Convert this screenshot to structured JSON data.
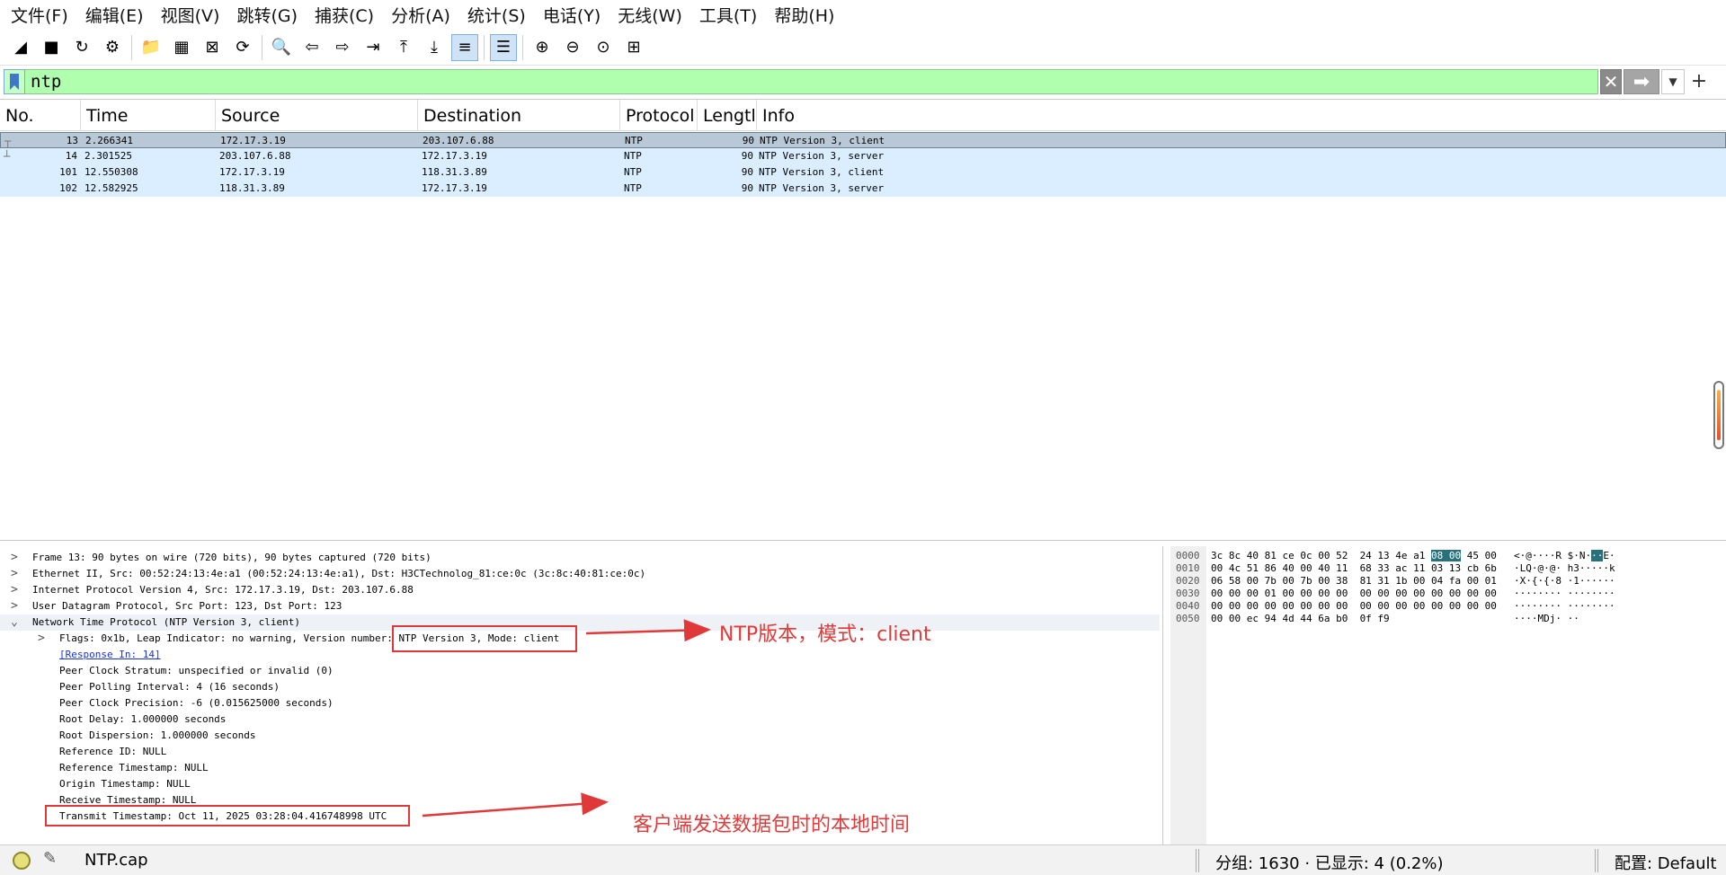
{
  "menu": [
    "文件(F)",
    "编辑(E)",
    "视图(V)",
    "跳转(G)",
    "捕获(C)",
    "分析(A)",
    "统计(S)",
    "电话(Y)",
    "无线(W)",
    "工具(T)",
    "帮助(H)"
  ],
  "toolbar": {
    "icons": [
      {
        "name": "start-capture-icon",
        "glyph": "◢"
      },
      {
        "name": "stop-capture-icon",
        "glyph": "■"
      },
      {
        "name": "restart-capture-icon",
        "glyph": "↻"
      },
      {
        "name": "capture-options-icon",
        "glyph": "⚙"
      },
      {
        "name": "sep"
      },
      {
        "name": "open-file-icon",
        "glyph": "📁"
      },
      {
        "name": "save-file-icon",
        "glyph": "▦"
      },
      {
        "name": "close-file-icon",
        "glyph": "⊠"
      },
      {
        "name": "reload-file-icon",
        "glyph": "⟳"
      },
      {
        "name": "sep"
      },
      {
        "name": "find-packet-icon",
        "glyph": "🔍"
      },
      {
        "name": "go-back-icon",
        "glyph": "⇦"
      },
      {
        "name": "go-forward-icon",
        "glyph": "⇨"
      },
      {
        "name": "go-to-packet-icon",
        "glyph": "⇥"
      },
      {
        "name": "go-first-packet-icon",
        "glyph": "⤒"
      },
      {
        "name": "go-last-packet-icon",
        "glyph": "⤓"
      },
      {
        "name": "auto-scroll-icon",
        "glyph": "≡",
        "active": true
      },
      {
        "name": "sep"
      },
      {
        "name": "colorize-icon",
        "glyph": "☰",
        "active": true
      },
      {
        "name": "sep"
      },
      {
        "name": "zoom-in-icon",
        "glyph": "⊕"
      },
      {
        "name": "zoom-out-icon",
        "glyph": "⊖"
      },
      {
        "name": "zoom-normal-icon",
        "glyph": "⊙"
      },
      {
        "name": "resize-columns-icon",
        "glyph": "⊞"
      }
    ]
  },
  "filter": {
    "value": "ntp",
    "clear_glyph": "✕",
    "apply_glyph": "➡",
    "dropdown_glyph": "▼",
    "add_glyph": "+"
  },
  "packet_list": {
    "columns": [
      "No.",
      "Time",
      "Source",
      "Destination",
      "Protocol",
      "Lengtl",
      "Info"
    ],
    "rows": [
      {
        "no": "13",
        "time": "2.266341",
        "src": "172.17.3.19",
        "dst": "203.107.6.88",
        "proto": "NTP",
        "len": "90",
        "info": "NTP Version 3, client",
        "selected": true
      },
      {
        "no": "14",
        "time": "2.301525",
        "src": "203.107.6.88",
        "dst": "172.17.3.19",
        "proto": "NTP",
        "len": "90",
        "info": "NTP Version 3, server"
      },
      {
        "no": "101",
        "time": "12.550308",
        "src": "172.17.3.19",
        "dst": "118.31.3.89",
        "proto": "NTP",
        "len": "90",
        "info": "NTP Version 3, client"
      },
      {
        "no": "102",
        "time": "12.582925",
        "src": "118.31.3.89",
        "dst": "172.17.3.19",
        "proto": "NTP",
        "len": "90",
        "info": "NTP Version 3, server"
      }
    ]
  },
  "details": {
    "frame": "Frame 13: 90 bytes on wire (720 bits), 90 bytes captured (720 bits)",
    "ethernet": "Ethernet II, Src: 00:52:24:13:4e:a1 (00:52:24:13:4e:a1), Dst: H3CTechnolog_81:ce:0c (3c:8c:40:81:ce:0c)",
    "ip": "Internet Protocol Version 4, Src: 172.17.3.19, Dst: 203.107.6.88",
    "udp": "User Datagram Protocol, Src Port: 123, Dst Port: 123",
    "ntp": "Network Time Protocol (NTP Version 3, client)",
    "flags_prefix": "Flags: 0x1b, Leap Indicator: no warning, Version number: ",
    "flags_suffix": "NTP Version 3, Mode: client",
    "response": "[Response In: 14]",
    "stratum": "Peer Clock Stratum: unspecified or invalid (0)",
    "polling": "Peer Polling Interval: 4 (16 seconds)",
    "precision": "Peer Clock Precision: -6 (0.015625000 seconds)",
    "root_delay": "Root Delay: 1.000000 seconds",
    "root_dispersion": "Root Dispersion: 1.000000 seconds",
    "reference_id": "Reference ID: NULL",
    "reference_ts": "Reference Timestamp: NULL",
    "origin_ts": "Origin Timestamp: NULL",
    "receive_ts": "Receive Timestamp: NULL",
    "transmit_ts": "Transmit Timestamp: Oct 11, 2025 03:28:04.416748998 UTC"
  },
  "annotations": {
    "version_mode": "NTP版本，模式：client",
    "transmit": "客户端发送数据包时的本地时间"
  },
  "bytes": [
    {
      "off": "0000",
      "hex_a": "3c 8c 40 81 ce 0c 00 52  24 13 4e a1 ",
      "hex_hl": "08 00",
      "hex_b": " 45 00",
      "ascii_a": "<·@····R $·N·",
      "ascii_hl": "··",
      "ascii_b": "E·"
    },
    {
      "off": "0010",
      "hex_a": "00 4c 51 86 40 00 40 11  68 33 ac 11 03 13 cb 6b",
      "ascii_a": "·LQ·@·@· h3·····k"
    },
    {
      "off": "0020",
      "hex_a": "06 58 00 7b 00 7b 00 38  81 31 1b 00 04 fa 00 01",
      "ascii_a": "·X·{·{·8 ·1······"
    },
    {
      "off": "0030",
      "hex_a": "00 00 00 01 00 00 00 00  00 00 00 00 00 00 00 00",
      "ascii_a": "········ ········"
    },
    {
      "off": "0040",
      "hex_a": "00 00 00 00 00 00 00 00  00 00 00 00 00 00 00 00",
      "ascii_a": "········ ········"
    },
    {
      "off": "0050",
      "hex_a": "00 00 ec 94 4d 44 6a b0  0f f9",
      "ascii_a": "····MDj· ··"
    }
  ],
  "status": {
    "file": "NTP.cap",
    "stats": "分组: 1630 · 已显示: 4 (0.2%)",
    "profile": "配置: Default"
  }
}
